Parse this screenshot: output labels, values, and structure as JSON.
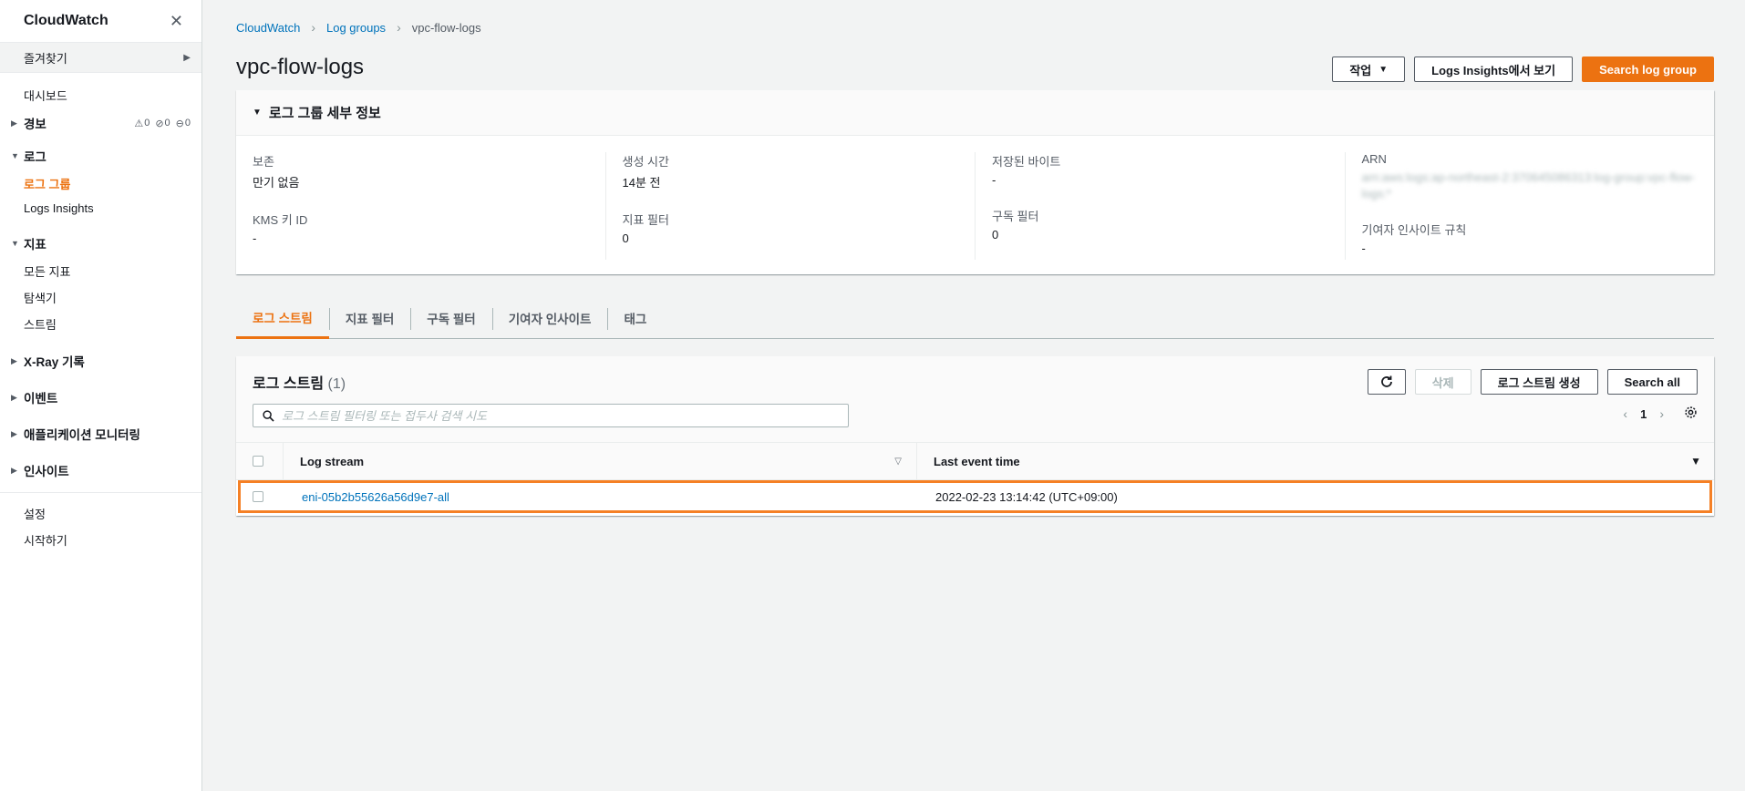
{
  "sidebar": {
    "title": "CloudWatch",
    "favorites": "즐겨찾기",
    "dashboard": "대시보드",
    "alarms": {
      "label": "경보",
      "alarm_count": "0",
      "ok_count": "0",
      "insufficient_count": "0"
    },
    "logs": {
      "label": "로그",
      "items": [
        "로그 그룹",
        "Logs Insights"
      ]
    },
    "metrics": {
      "label": "지표",
      "items": [
        "모든 지표",
        "탐색기",
        "스트림"
      ]
    },
    "xray": "X-Ray 기록",
    "events": "이벤트",
    "app_monitoring": "애플리케이션 모니터링",
    "insights": "인사이트",
    "settings": "설정",
    "getting_started": "시작하기"
  },
  "breadcrumb": [
    "CloudWatch",
    "Log groups",
    "vpc-flow-logs"
  ],
  "page_title": "vpc-flow-logs",
  "header_actions": {
    "actions": "작업",
    "view_insights": "Logs Insights에서 보기",
    "search_log_group": "Search log group"
  },
  "details": {
    "title": "로그 그룹 세부 정보",
    "retention_label": "보존",
    "retention_value": "만기 없음",
    "kms_label": "KMS 키 ID",
    "kms_value": "-",
    "created_label": "생성 시간",
    "created_value": "14분 전",
    "metric_filters_label": "지표 필터",
    "metric_filters_value": "0",
    "stored_bytes_label": "저장된 바이트",
    "stored_bytes_value": "-",
    "subscription_label": "구독 필터",
    "subscription_value": "0",
    "arn_label": "ARN",
    "arn_value": "arn:aws:logs:ap-northeast-2:370645086313:log-group:vpc-flow-logs:*",
    "contributor_label": "기여자 인사이트 규칙",
    "contributor_value": "-"
  },
  "tabs": [
    "로그 스트림",
    "지표 필터",
    "구독 필터",
    "기여자 인사이트",
    "태그"
  ],
  "streams": {
    "title": "로그 스트림",
    "count": "(1)",
    "delete": "삭제",
    "create": "로그 스트림 생성",
    "search_all": "Search all",
    "search_placeholder": "로그 스트림 필터링 또는 접두사 검색 시도",
    "page": "1",
    "columns": {
      "stream": "Log stream",
      "time": "Last event time"
    },
    "rows": [
      {
        "name": "eni-05b2b55626a56d9e7-all",
        "time": "2022-02-23 13:14:42 (UTC+09:00)"
      }
    ]
  },
  "colors": {
    "accent": "#ec7211",
    "link": "#0073bb",
    "highlight": "#f58025"
  }
}
